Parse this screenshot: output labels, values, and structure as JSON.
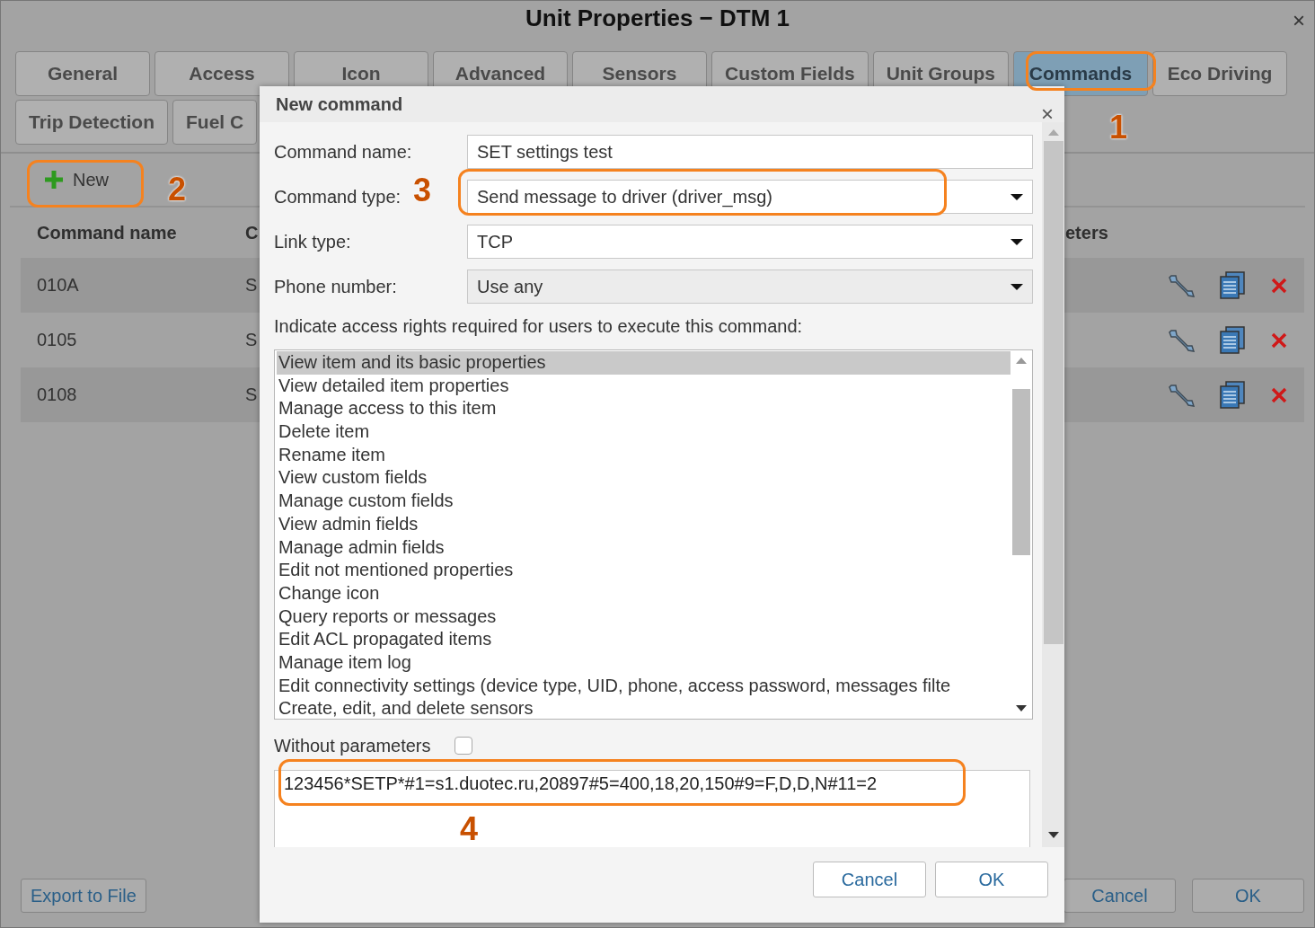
{
  "window": {
    "title": "Unit Properties − DTM 1",
    "close": "×"
  },
  "tabs": [
    {
      "label": "General",
      "selected": false
    },
    {
      "label": "Access",
      "selected": false
    },
    {
      "label": "Icon",
      "selected": false
    },
    {
      "label": "Advanced",
      "selected": false
    },
    {
      "label": "Sensors",
      "selected": false
    },
    {
      "label": "Custom Fields",
      "selected": false
    },
    {
      "label": "Unit Groups",
      "selected": false
    },
    {
      "label": "Commands",
      "selected": true
    },
    {
      "label": "Eco Driving",
      "selected": false
    },
    {
      "label": "Trip Detection",
      "selected": false
    },
    {
      "label": "Fuel C",
      "selected": false
    }
  ],
  "toolbar": {
    "new_button": "New"
  },
  "table": {
    "columns": [
      "Command name",
      "C",
      "eters"
    ],
    "rows": [
      {
        "name": "010A",
        "column_2": "S"
      },
      {
        "name": "0105",
        "column_2": "S"
      },
      {
        "name": "0108",
        "column_2": "S"
      }
    ]
  },
  "footer": {
    "export_button": "Export to File",
    "cancel_button": "Cancel",
    "ok_button": "OK"
  },
  "dialog": {
    "title": "New command",
    "close": "×",
    "fields": [
      {
        "label": "Command name:",
        "value": "SET settings test",
        "kind": "text",
        "disabled": false
      },
      {
        "label": "Command type:",
        "value": "Send message to driver (driver_msg)",
        "kind": "select",
        "disabled": false
      },
      {
        "label": "Link type:",
        "value": "TCP",
        "kind": "select",
        "disabled": false
      },
      {
        "label": "Phone number:",
        "value": "Use any",
        "kind": "select",
        "disabled": true
      }
    ],
    "access_label": "Indicate access rights required for users to execute this command:",
    "rights": [
      {
        "label": "View item and its basic properties",
        "selected": true
      },
      {
        "label": "View detailed item properties",
        "selected": false
      },
      {
        "label": "Manage access to this item",
        "selected": false
      },
      {
        "label": "Delete item",
        "selected": false
      },
      {
        "label": "Rename item",
        "selected": false
      },
      {
        "label": "View custom fields",
        "selected": false
      },
      {
        "label": "Manage custom fields",
        "selected": false
      },
      {
        "label": "View admin fields",
        "selected": false
      },
      {
        "label": "Manage admin fields",
        "selected": false
      },
      {
        "label": "Edit not mentioned properties",
        "selected": false
      },
      {
        "label": "Change icon",
        "selected": false
      },
      {
        "label": "Query reports or messages",
        "selected": false
      },
      {
        "label": "Edit ACL propagated items",
        "selected": false
      },
      {
        "label": "Manage item log",
        "selected": false
      },
      {
        "label": "Edit connectivity settings (device type, UID, phone, access password, messages filte",
        "selected": false
      },
      {
        "label": "Create, edit, and delete sensors",
        "selected": false
      }
    ],
    "without_parameters": {
      "label": "Without parameters",
      "checked": false
    },
    "parameters": "123456*SETP*#1=s1.duotec.ru,20897#5=400,18,20,150#9=F,D,D,N#11=2",
    "cancel_button": "Cancel",
    "ok_button": "OK"
  },
  "annotations": [
    "1",
    "2",
    "3",
    "4"
  ]
}
